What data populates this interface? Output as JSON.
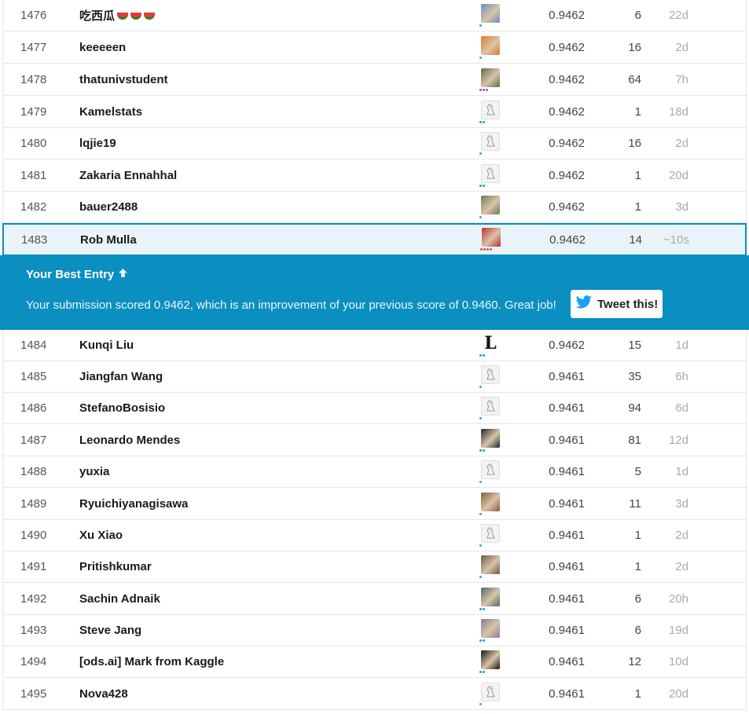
{
  "rows": [
    {
      "rank": "1476",
      "name": "吃西瓜",
      "emoji": 3,
      "score": "0.9462",
      "entries": "6",
      "last": "22d",
      "avatar": "#6a8fc4",
      "tier": [
        "#1fb6c8"
      ]
    },
    {
      "rank": "1477",
      "name": "keeeeen",
      "score": "0.9462",
      "entries": "16",
      "last": "2d",
      "avatar": "#e07a2e",
      "tier": [
        "#1fb6c8"
      ]
    },
    {
      "rank": "1478",
      "name": "thatunivstudent",
      "score": "0.9462",
      "entries": "64",
      "last": "7h",
      "avatar": "#5d6b4a",
      "tier": [
        "#a84fa8",
        "#a84fa8",
        "#a84fa8"
      ]
    },
    {
      "rank": "1479",
      "name": "Kamelstats",
      "score": "0.9462",
      "entries": "1",
      "last": "18d",
      "avatar": "ghost",
      "tier": [
        "#1a9fd6",
        "#1a9fd6"
      ]
    },
    {
      "rank": "1480",
      "name": "lqjie19",
      "score": "0.9462",
      "entries": "16",
      "last": "2d",
      "avatar": "ghost",
      "tier": [
        "#1fb6c8"
      ]
    },
    {
      "rank": "1481",
      "name": "Zakaria Ennahhal",
      "score": "0.9462",
      "entries": "1",
      "last": "20d",
      "avatar": "ghost",
      "tier": [
        "#1a9fd6",
        "#1a9fd6"
      ]
    },
    {
      "rank": "1482",
      "name": "bauer2488",
      "score": "0.9462",
      "entries": "1",
      "last": "3d",
      "avatar": "#6e7a5a",
      "tier": [
        "#1fb6c8"
      ]
    },
    {
      "rank": "1483",
      "name": "Rob Mulla",
      "score": "0.9462",
      "entries": "14",
      "last": "~10s",
      "avatar": "#b8322e",
      "tier": [
        "#e8453c",
        "#e8453c",
        "#e8453c",
        "#e8453c"
      ],
      "me": true
    },
    {
      "rank": "1484",
      "name": "Kunqi Liu",
      "score": "0.9462",
      "entries": "15",
      "last": "1d",
      "avatar": "letter",
      "letter": "L",
      "tier": [
        "#1a9fd6",
        "#1a9fd6"
      ]
    },
    {
      "rank": "1485",
      "name": "Jiangfan Wang",
      "score": "0.9461",
      "entries": "35",
      "last": "6h",
      "avatar": "ghost",
      "tier": [
        "#1fb6c8"
      ]
    },
    {
      "rank": "1486",
      "name": "StefanoBosisio",
      "score": "0.9461",
      "entries": "94",
      "last": "6d",
      "avatar": "ghost",
      "tier": [
        "#1fb6c8"
      ]
    },
    {
      "rank": "1487",
      "name": "Leonardo Mendes",
      "score": "0.9461",
      "entries": "81",
      "last": "12d",
      "avatar": "#1c2630",
      "tier": [
        "#1a9fd6",
        "#1a9fd6"
      ]
    },
    {
      "rank": "1488",
      "name": "yuxia",
      "score": "0.9461",
      "entries": "5",
      "last": "1d",
      "avatar": "ghost",
      "tier": [
        "#1fb6c8"
      ]
    },
    {
      "rank": "1489",
      "name": "Ryuichiyanagisawa",
      "score": "0.9461",
      "entries": "11",
      "last": "3d",
      "avatar": "#8a5a3c",
      "tier": [
        "#1fb6c8"
      ]
    },
    {
      "rank": "1490",
      "name": "Xu Xiao",
      "score": "0.9461",
      "entries": "1",
      "last": "2d",
      "avatar": "ghost",
      "tier": [
        "#1fb6c8"
      ]
    },
    {
      "rank": "1491",
      "name": "Pritishkumar",
      "score": "0.9461",
      "entries": "1",
      "last": "2d",
      "avatar": "#6b5a48",
      "tier": [
        "#1fb6c8"
      ]
    },
    {
      "rank": "1492",
      "name": "Sachin Adnaik",
      "score": "0.9461",
      "entries": "6",
      "last": "20h",
      "avatar": "#4f6a6a",
      "tier": [
        "#1a9fd6",
        "#1a9fd6"
      ]
    },
    {
      "rank": "1493",
      "name": "Steve Jang",
      "score": "0.9461",
      "entries": "6",
      "last": "19d",
      "avatar": "#8a7a9a",
      "tier": [
        "#1a9fd6",
        "#1a9fd6"
      ]
    },
    {
      "rank": "1494",
      "name": "[ods.ai] Mark from Kaggle",
      "score": "0.9461",
      "entries": "12",
      "last": "10d",
      "avatar": "#141414",
      "tier": [
        "#1a9fd6",
        "#1a9fd6"
      ]
    },
    {
      "rank": "1495",
      "name": "Nova428",
      "score": "0.9461",
      "entries": "1",
      "last": "20d",
      "avatar": "ghost",
      "tier": [
        "#1fb6c8"
      ]
    }
  ],
  "banner": {
    "title": "Your Best Entry",
    "message": "Your submission scored 0.9462, which is an improvement of your previous score of 0.9460. Great job!",
    "tweet_label": "Tweet this!"
  },
  "colors": {
    "accent": "#0a8fc0",
    "highlight": "#e8f4fa"
  }
}
